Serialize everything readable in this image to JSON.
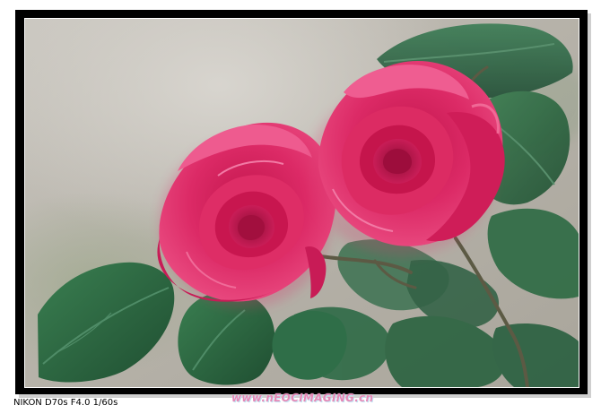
{
  "photo": {
    "subject": "two pink roses with green leaves"
  },
  "caption": {
    "exif": "NIKON D70s F4.0 1/60s"
  },
  "watermark": {
    "text": "www.nEOCIMAGING.cn"
  },
  "colors": {
    "frame": "#000000",
    "rose": "#d21e5b",
    "leaf": "#2f6f45",
    "background_blur": "#bdbab2",
    "watermark": "#e489b7"
  }
}
